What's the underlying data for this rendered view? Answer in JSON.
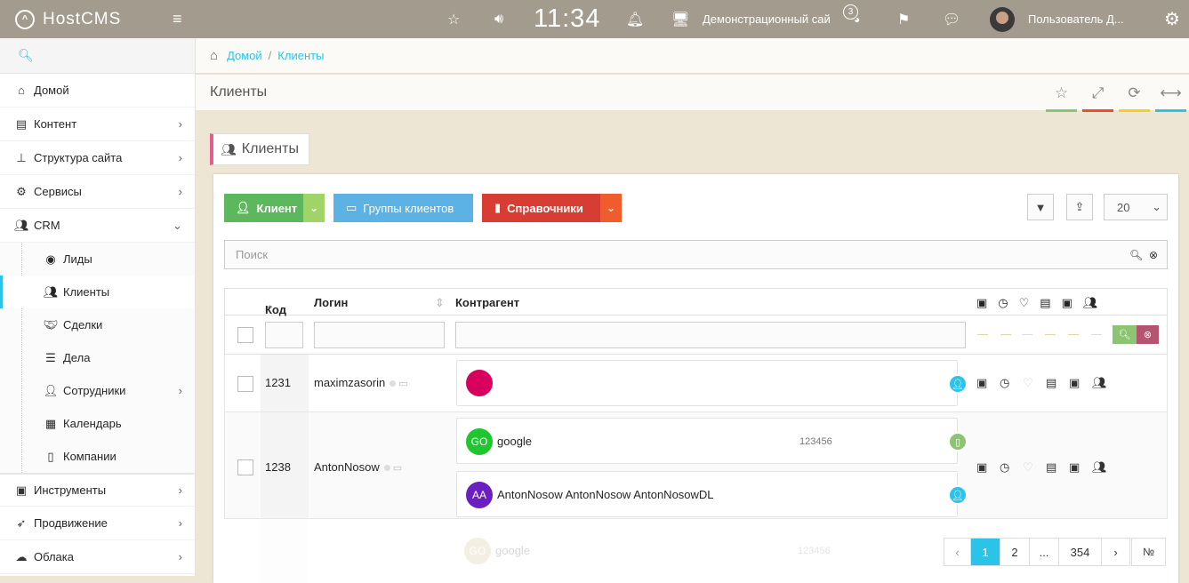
{
  "topbar": {
    "brand": "HostCMS",
    "time": "11:34",
    "site": "Демонстрационный сай",
    "badge": "3",
    "user": "Пользователь Д..."
  },
  "sidebar": {
    "items": [
      {
        "icon": "home-icon",
        "label": "Домой"
      },
      {
        "icon": "newspaper-icon",
        "label": "Контент"
      },
      {
        "icon": "sitemap-icon",
        "label": "Структура сайта"
      },
      {
        "icon": "cogs-icon",
        "label": "Сервисы"
      },
      {
        "icon": "users-icon",
        "label": "CRM"
      }
    ],
    "crm_sub": [
      {
        "icon": "user-circle-icon",
        "label": "Лиды"
      },
      {
        "icon": "users-icon",
        "label": "Клиенты"
      },
      {
        "icon": "handshake-icon",
        "label": "Сделки"
      },
      {
        "icon": "tasks-icon",
        "label": "Дела"
      },
      {
        "icon": "user-icon",
        "label": "Сотрудники"
      },
      {
        "icon": "calendar-icon",
        "label": "Календарь"
      },
      {
        "icon": "building-icon",
        "label": "Компании"
      }
    ],
    "bottom": [
      {
        "icon": "briefcase-icon",
        "label": "Инструменты"
      },
      {
        "icon": "rocket-icon",
        "label": "Продвижение"
      },
      {
        "icon": "cloud-icon",
        "label": "Облака"
      }
    ]
  },
  "breadcrumb": {
    "home": "Домой",
    "sep": "/",
    "current": "Клиенты"
  },
  "page": {
    "title": "Клиенты",
    "tab": "Клиенты"
  },
  "toolbar": {
    "client_btn": "Клиент",
    "groups_btn": "Группы клиентов",
    "refs_btn": "Справочники",
    "per_page": "20",
    "search_placeholder": "Поиск"
  },
  "table": {
    "col_code": "Код",
    "col_login": "Логин",
    "col_contractor": "Контрагент"
  },
  "rows": [
    {
      "code": "1231",
      "login": "maximzasorin"
    },
    {
      "code": "1238",
      "login": "AntonNosow",
      "card1_initials": "GO",
      "card1_name": "google",
      "card1_num": "123456",
      "card2_initials": "AA",
      "card2_name": "AntonNosow AntonNosow AntonNosowDL"
    }
  ],
  "ghost": {
    "initials": "GO",
    "name": "google",
    "num": "123456"
  },
  "pagination": {
    "p1": "1",
    "p2": "2",
    "dots": "...",
    "last": "354",
    "prev": "‹",
    "next": "›",
    "no": "№"
  },
  "colors": {
    "accent": "#2dc3e8",
    "topbar": "#a39c8e",
    "green": "#5db75d",
    "sky": "#5db2e5",
    "red": "#d73d32",
    "orange": "#f05c2c",
    "pink": "#d8005d",
    "green_av": "#20c62e",
    "purple_av": "#6b1fc1"
  }
}
